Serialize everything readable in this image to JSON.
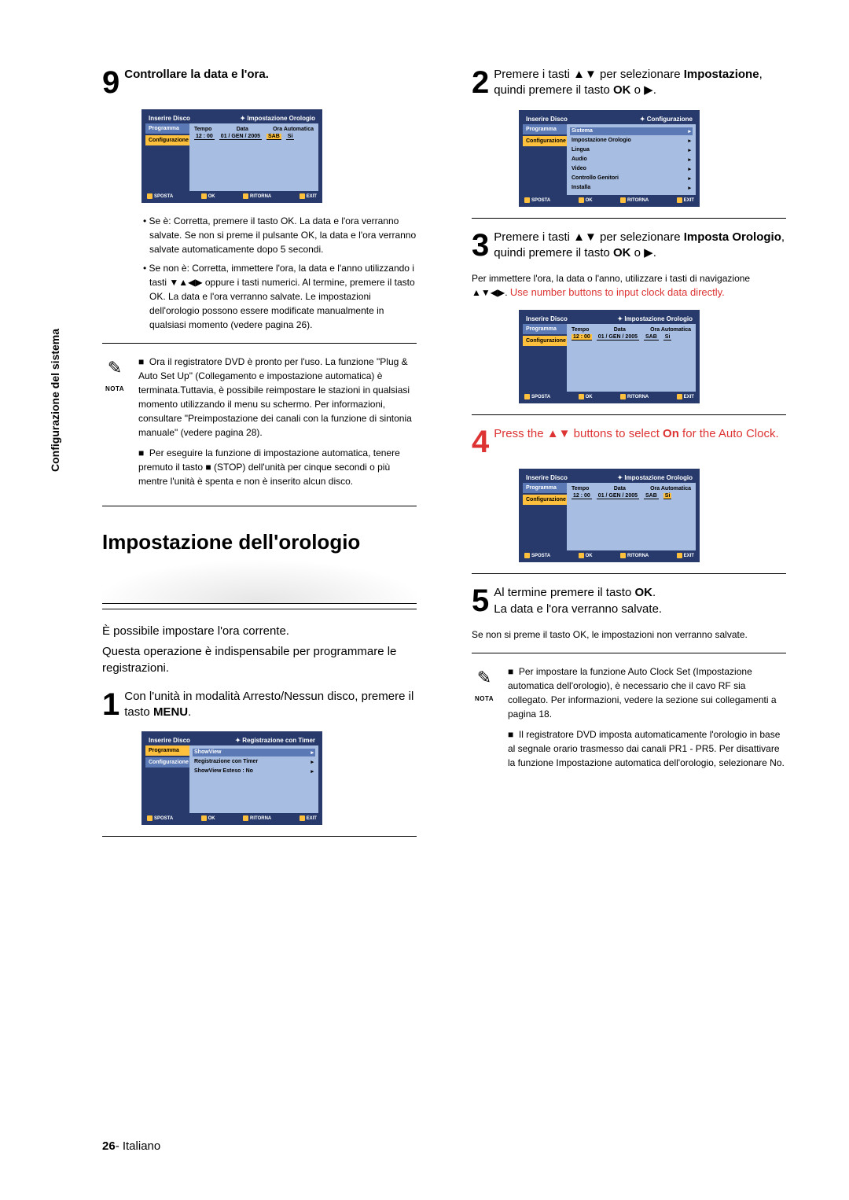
{
  "side_label": "Configurazione del sistema",
  "page_footer_num": "26",
  "page_footer_lang": "- Italiano",
  "osd_common": {
    "insert_disc": "Inserire Disco",
    "prog": "Programma",
    "conf": "Configurazione",
    "foot_sposta": "SPOSTA",
    "foot_ok": "OK",
    "foot_ritorna": "RITORNA",
    "foot_exit": "EXIT",
    "ora_header": "Impostazione Orologio",
    "conf_header": "Configurazione",
    "rec_header": "Registrazione con Timer",
    "labels_tempo": "Tempo",
    "labels_data": "Data",
    "labels_oraauto": "Ora Automatica",
    "val_time": "12 : 00",
    "val_date": "01 / GEN / 2005",
    "val_sab": "SAB",
    "val_si": "Si",
    "conf_items": [
      "Sistema",
      "Impostazione Orologio",
      "Lingua",
      "Audio",
      "Video",
      "Controllo Genitori",
      "Installa"
    ],
    "rec_items": [
      "ShowView",
      "Registrazione con Timer",
      "ShowView Esteso : No"
    ]
  },
  "left": {
    "step9_num": "9",
    "step9_title": "Controllare la data e l'ora.",
    "step9_b1": "• Se è: Corretta, premere il tasto OK. La data e l'ora verranno salvate. Se non si preme il pulsante OK, la data e l'ora verranno salvate automaticamente dopo 5 secondi.",
    "step9_b2": "• Se non è: Corretta, immettere l'ora, la data e l'anno utilizzando i tasti ▼▲◀▶ oppure i tasti numerici. Al termine, premere il tasto OK. La data e l'ora verranno salvate. Le impostazioni dell'orologio possono essere modificate manualmente in qualsiasi momento (vedere pagina 26).",
    "nota_label": "NOTA",
    "nota_p1": "Ora il registratore DVD è pronto per l'uso. La funzione \"Plug & Auto Set Up\" (Collegamento e impostazione automatica) è terminata.Tuttavia, è possibile reimpostare le stazioni in qualsiasi momento utilizzando il menu su schermo. Per informazioni, consultare \"Preimpostazione dei canali con la funzione di sintonia manuale\" (vedere pagina 28).",
    "nota_p2": "Per eseguire la funzione di impostazione automatica, tenere premuto il tasto ■ (STOP) dell'unità per cinque secondi o più mentre l'unità è spenta e non è inserito alcun disco.",
    "heading": "Impostazione dell'orologio",
    "intro1": "È possibile impostare l'ora corrente.",
    "intro2": "Questa operazione è indispensabile per programmare le registrazioni.",
    "step1_num": "1",
    "step1_a": "Con l'unità in modalità Arresto/Nessun disco, premere il tasto ",
    "step1_b": "MENU",
    "step1_c": "."
  },
  "right": {
    "step2_num": "2",
    "step2_a": "Premere i tasti ▲▼ per selezionare ",
    "step2_b": "Impostazione",
    "step2_c": ", quindi premere il tasto ",
    "step2_d": "OK",
    "step2_e": " o ▶.",
    "step3_num": "3",
    "step3_a": "Premere i tasti ▲▼ per selezionare ",
    "step3_b": "Imposta Orologio",
    "step3_c": ", quindi premere il tasto ",
    "step3_d": "OK",
    "step3_e": " o ▶.",
    "step3_sub": "Per immettere l'ora, la data o l'anno, utilizzare i tasti di navigazione ▲▼◀▶. ",
    "step3_sub_red": "Use number buttons to input clock data directly.",
    "step4_num": "4",
    "step4_a": "Press the ▲▼ buttons to select ",
    "step4_b": "On",
    "step4_c": " for the Auto Clock.",
    "step5_num": "5",
    "step5_a": "Al termine premere il tasto ",
    "step5_b": "OK",
    "step5_c": ".",
    "step5_line2": "La data e l'ora verranno salvate.",
    "step5_sub": "Se non si preme il tasto OK, le impostazioni non verranno salvate.",
    "nota_label": "NOTA",
    "nota_p1": "Per impostare la funzione Auto Clock Set (Impostazione automatica dell'orologio), è necessario che il cavo RF sia collegato. Per informazioni, vedere la sezione sui collegamenti a pagina 18.",
    "nota_p2": "Il registratore DVD imposta automaticamente l'orologio in base al segnale orario trasmesso dai canali PR1 - PR5. Per disattivare la funzione Impostazione automatica dell'orologio, selezionare No."
  }
}
